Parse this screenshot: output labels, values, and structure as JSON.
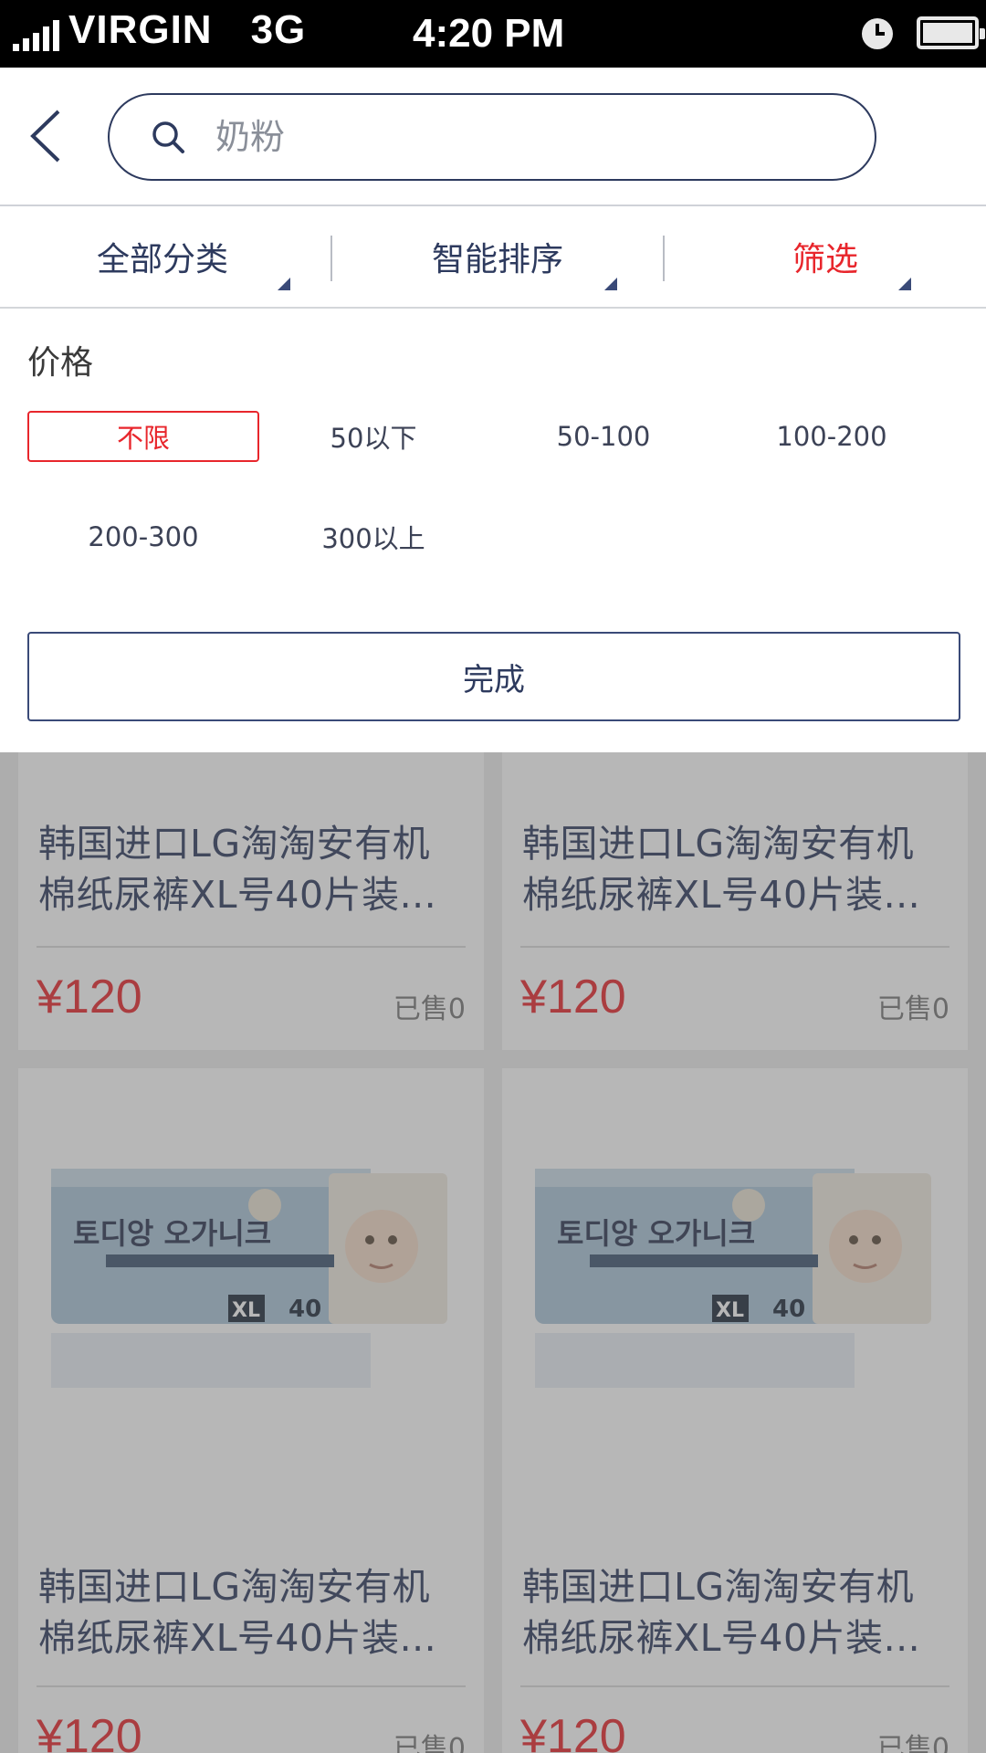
{
  "status_bar": {
    "carrier": "VIRGIN",
    "network": "3G",
    "time": "4:20 PM"
  },
  "search": {
    "placeholder": "奶粉"
  },
  "tabs": [
    {
      "label": "全部分类",
      "active": false
    },
    {
      "label": "智能排序",
      "active": false
    },
    {
      "label": "筛选",
      "active": true
    }
  ],
  "filter": {
    "price_label": "价格",
    "options": [
      "不限",
      "50以下",
      "50-100",
      "100-200",
      "200-300",
      "300以上"
    ],
    "selected": "不限",
    "done_label": "完成"
  },
  "products": [
    {
      "title": "韩国进口LG淘淘安有机棉纸尿裤XL号40片装...",
      "price": "¥120",
      "sold": "已售0"
    },
    {
      "title": "韩国进口LG淘淘安有机棉纸尿裤XL号40片装...",
      "price": "¥120",
      "sold": "已售0"
    },
    {
      "title": "韩国进口LG淘淘安有机棉纸尿裤XL号40片装...",
      "price": "¥120",
      "sold": "已售0",
      "image_text": "토디앙 오가니크",
      "image_size": "XL",
      "image_count": "40"
    },
    {
      "title": "韩国进口LG淘淘安有机棉纸尿裤XL号40片装...",
      "price": "¥120",
      "sold": "已售0",
      "image_text": "토디앙 오가니크",
      "image_size": "XL",
      "image_count": "40"
    }
  ],
  "colors": {
    "accent_red": "#e8262c",
    "navy": "#2d3a5e"
  }
}
